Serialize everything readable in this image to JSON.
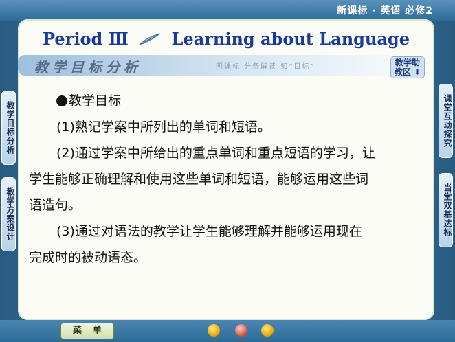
{
  "header": {
    "course_label": "新课标 · 英语   必修2"
  },
  "title": {
    "left": "Period Ⅲ",
    "right": "Learning about Language"
  },
  "section": {
    "title": "教学目标分析",
    "hint": "明课标  分条解读  知“目标”"
  },
  "help_button": {
    "line1": "教学助",
    "line2": "教区 ⬇"
  },
  "left_tabs": [
    {
      "label": "教学目标分析"
    },
    {
      "label": "教学方案设计"
    }
  ],
  "right_tabs": [
    {
      "label": "课堂互动探究"
    },
    {
      "label": "当堂双基达标"
    }
  ],
  "content": {
    "heading": "教学目标",
    "item1": "(1)熟记学案中所列出的单词和短语。",
    "item2a": "(2)通过学案中所给出的重点单词和重点短语的学习，让",
    "item2b": "学生能够正确理解和使用这些单词和短语，能够运用这些词",
    "item2c": "语造句。",
    "item3a": "(3)通过对语法的教学让学生能够理解并能够运用现在",
    "item3b": "完成时的被动语态。"
  },
  "footer": {
    "menu_label": "菜单"
  },
  "colors": {
    "title_blue": "#1a3b9a",
    "frame_blue": "#2d6b97",
    "panel": "#fbfcf5"
  },
  "icons": [
    "prev-icon",
    "home-icon",
    "next-icon"
  ]
}
